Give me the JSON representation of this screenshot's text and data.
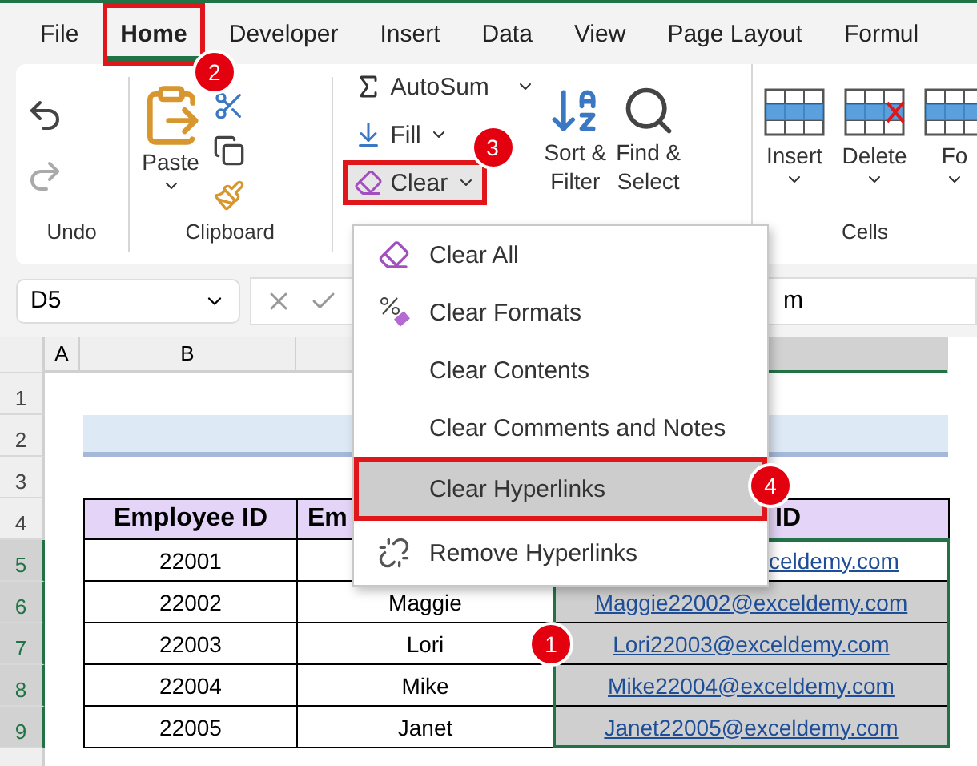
{
  "tabs": [
    {
      "label": "File",
      "selected": false,
      "highlighted": false
    },
    {
      "label": "Home",
      "selected": true,
      "highlighted": true,
      "badge": "2"
    },
    {
      "label": "Developer",
      "selected": false,
      "highlighted": false
    },
    {
      "label": "Insert",
      "selected": false,
      "highlighted": false
    },
    {
      "label": "Data",
      "selected": false,
      "highlighted": false
    },
    {
      "label": "View",
      "selected": false,
      "highlighted": false
    },
    {
      "label": "Page Layout",
      "selected": false,
      "highlighted": false
    },
    {
      "label": "Formul",
      "selected": false,
      "highlighted": false
    }
  ],
  "ribbon": {
    "undo": {
      "label": "Undo"
    },
    "clipboard": {
      "label": "Clipboard",
      "paste": "Paste"
    },
    "editing": {
      "autosum": "AutoSum",
      "fill": "Fill",
      "clear": {
        "label": "Clear",
        "highlighted": true,
        "expanded": true,
        "badge": "3"
      },
      "sort": [
        "Sort &",
        "Filter"
      ],
      "find": [
        "Find &",
        "Select"
      ]
    },
    "cells": {
      "label": "Cells",
      "buttons": [
        "Insert",
        "Delete",
        "Fo"
      ]
    }
  },
  "formula_bar": {
    "name_box": "D5",
    "value": "m"
  },
  "sheet": {
    "column_headers": [
      {
        "label": "A",
        "selected": false
      },
      {
        "label": "B",
        "selected": false
      },
      {
        "selected": false
      },
      {
        "selected": true
      }
    ],
    "row_numbers": [
      "1",
      "2",
      "3",
      "4"
    ],
    "table_header": [
      "Employee ID",
      "Em",
      "ID"
    ],
    "rows": [
      {
        "number": "5",
        "id": "22001",
        "email": "celdemy.com",
        "selected": true,
        "active": true
      },
      {
        "number": "6",
        "id": "22002",
        "name": "Maggie",
        "email": "Maggie22002@exceldemy.com",
        "selected": true,
        "active": false
      },
      {
        "number": "7",
        "id": "22003",
        "name": "Lori",
        "email": "Lori22003@exceldemy.com",
        "selected": true,
        "active": false,
        "badge": "1"
      },
      {
        "number": "8",
        "id": "22004",
        "name": "Mike",
        "email": "Mike22004@exceldemy.com",
        "selected": true,
        "active": false
      },
      {
        "number": "9",
        "id": "22005",
        "name": "Janet",
        "email": "Janet22005@exceldemy.com",
        "selected": true,
        "active": false
      }
    ]
  },
  "menu": {
    "items": [
      {
        "label": "Clear All",
        "selected": false,
        "highlighted": false
      },
      {
        "label": "Clear Formats",
        "selected": false,
        "highlighted": false
      },
      {
        "label": "Clear Contents",
        "selected": false,
        "highlighted": false
      },
      {
        "label": "Clear Comments and Notes",
        "selected": false,
        "highlighted": false
      },
      {
        "label": "Clear Hyperlinks",
        "selected": true,
        "highlighted": true,
        "badge": "4"
      },
      {
        "label": "Remove Hyperlinks",
        "selected": false,
        "highlighted": false
      }
    ]
  }
}
